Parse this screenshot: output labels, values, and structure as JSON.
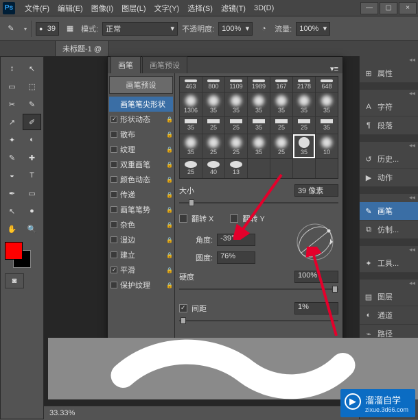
{
  "menu": {
    "items": [
      "文件(F)",
      "编辑(E)",
      "图像(I)",
      "图层(L)",
      "文字(Y)",
      "选择(S)",
      "滤镜(T)",
      "3D(D)"
    ]
  },
  "window": {
    "min": "—",
    "max": "▢",
    "close": "×"
  },
  "options": {
    "brush_size": "39",
    "mode_label": "模式:",
    "mode_value": "正常",
    "opacity_label": "不透明度:",
    "opacity_value": "100%",
    "flow_label": "流量:",
    "flow_value": "100%"
  },
  "doc_tab": "未标题-1 @",
  "zoom": "33.33%",
  "toolbox_icons": [
    [
      "↕",
      "↖"
    ],
    [
      "▭",
      "⬚"
    ],
    [
      "✂",
      "✎"
    ],
    [
      "↗",
      "✐"
    ],
    [
      "✦",
      "◐"
    ],
    [
      "✎",
      "✚"
    ],
    [
      "◒",
      "T"
    ],
    [
      "✒",
      "▭"
    ],
    [
      "↖",
      "●"
    ],
    [
      "✋",
      "🔍"
    ]
  ],
  "brush_panel": {
    "tabs": [
      "画笔",
      "画笔预设"
    ],
    "preset_btn": "画笔预设",
    "sidebar": [
      {
        "label": "画笔笔尖形状",
        "check": false,
        "selected": true
      },
      {
        "label": "形状动态",
        "check": true
      },
      {
        "label": "散布",
        "check": false
      },
      {
        "label": "纹理",
        "check": false
      },
      {
        "label": "双重画笔",
        "check": false
      },
      {
        "label": "颜色动态",
        "check": false
      },
      {
        "label": "传递",
        "check": false
      },
      {
        "label": "画笔笔势",
        "check": false
      },
      {
        "label": "杂色",
        "check": false
      },
      {
        "label": "湿边",
        "check": false
      },
      {
        "label": "建立",
        "check": false
      },
      {
        "label": "平滑",
        "check": true
      },
      {
        "label": "保护纹理",
        "check": false
      }
    ],
    "tips_row1": [
      "463",
      "800",
      "1109",
      "1989",
      "167",
      "2178",
      "648"
    ],
    "tips_row2": [
      "1306",
      "35",
      "35",
      "35",
      "35",
      "35",
      "35"
    ],
    "tips_row3": [
      "35",
      "25",
      "25",
      "35",
      "25",
      "25",
      "35"
    ],
    "tips_row4": [
      "35",
      "25",
      "25",
      "35",
      "25",
      "35",
      "10"
    ],
    "tips_row5": [
      "25",
      "40",
      "13",
      "",
      "",
      "",
      ""
    ],
    "size_label": "大小",
    "size_value": "39 像素",
    "flip_x": "翻转 X",
    "flip_y": "翻转 Y",
    "angle_label": "角度:",
    "angle_value": "-39°",
    "roundness_label": "圆度:",
    "roundness_value": "76%",
    "hardness_label": "硬度",
    "hardness_value": "100%",
    "spacing_check": true,
    "spacing_label": "间距",
    "spacing_value": "1%"
  },
  "right_panels": {
    "group1": [
      "属性"
    ],
    "group2": [
      "字符",
      "段落"
    ],
    "group3": [
      "历史...",
      "动作"
    ],
    "group4": [
      "画笔",
      "仿制..."
    ],
    "group5": [
      "工具..."
    ],
    "group6": [
      "图层",
      "通道",
      "路径"
    ]
  },
  "watermark": {
    "title": "溜溜自学",
    "sub": "zixue.3d66.com"
  }
}
